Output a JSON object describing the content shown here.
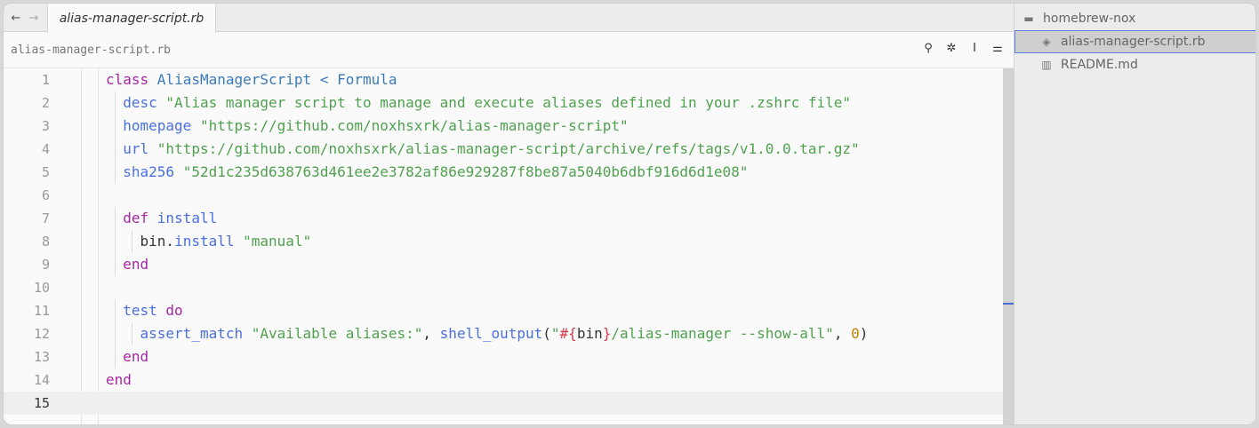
{
  "tabbar": {
    "back_icon": "arrow-left-icon",
    "forward_icon": "arrow-right-icon",
    "active_tab": "alias-manager-script.rb"
  },
  "breadcrumb": "alias-manager-script.rb",
  "toolbar_icons": [
    "search-icon",
    "sparkle-icon",
    "text-cursor-icon",
    "sliders-icon"
  ],
  "editor": {
    "active_line": 15,
    "lines": [
      {
        "n": "1",
        "indent": 0,
        "tokens": [
          [
            "kw",
            "class "
          ],
          [
            "cls",
            "AliasManagerScript"
          ],
          [
            "plain",
            " "
          ],
          [
            "cls",
            "< Formula"
          ]
        ]
      },
      {
        "n": "2",
        "indent": 1,
        "tokens": [
          [
            "fn",
            "desc"
          ],
          [
            "plain",
            " "
          ],
          [
            "str",
            "\"Alias manager script to manage and execute aliases defined in your .zshrc file\""
          ]
        ]
      },
      {
        "n": "3",
        "indent": 1,
        "tokens": [
          [
            "fn",
            "homepage"
          ],
          [
            "plain",
            " "
          ],
          [
            "str",
            "\"https://github.com/noxhsxrk/alias-manager-script\""
          ]
        ]
      },
      {
        "n": "4",
        "indent": 1,
        "tokens": [
          [
            "fn",
            "url"
          ],
          [
            "plain",
            " "
          ],
          [
            "str",
            "\"https://github.com/noxhsxrk/alias-manager-script/archive/refs/tags/v1.0.0.tar.gz\""
          ]
        ]
      },
      {
        "n": "5",
        "indent": 1,
        "tokens": [
          [
            "fn",
            "sha256"
          ],
          [
            "plain",
            " "
          ],
          [
            "str",
            "\"52d1c235d638763d461ee2e3782af86e929287f8be87a5040b6dbf916d6d1e08\""
          ]
        ]
      },
      {
        "n": "6",
        "indent": 0,
        "tokens": []
      },
      {
        "n": "7",
        "indent": 1,
        "tokens": [
          [
            "kw",
            "def"
          ],
          [
            "plain",
            " "
          ],
          [
            "fn",
            "install"
          ]
        ]
      },
      {
        "n": "8",
        "indent": 2,
        "tokens": [
          [
            "plain",
            "bin"
          ],
          [
            "plain",
            "."
          ],
          [
            "fn",
            "install"
          ],
          [
            "plain",
            " "
          ],
          [
            "str",
            "\"manual\""
          ]
        ]
      },
      {
        "n": "9",
        "indent": 1,
        "tokens": [
          [
            "kw",
            "end"
          ]
        ]
      },
      {
        "n": "10",
        "indent": 0,
        "tokens": []
      },
      {
        "n": "11",
        "indent": 1,
        "tokens": [
          [
            "fn",
            "test"
          ],
          [
            "plain",
            " "
          ],
          [
            "kw",
            "do"
          ]
        ]
      },
      {
        "n": "12",
        "indent": 2,
        "tokens": [
          [
            "fn",
            "assert_match"
          ],
          [
            "plain",
            " "
          ],
          [
            "str",
            "\"Available aliases:\""
          ],
          [
            "plain",
            ", "
          ],
          [
            "fn",
            "shell_output"
          ],
          [
            "plain",
            "("
          ],
          [
            "str",
            "\""
          ],
          [
            "int",
            "#{"
          ],
          [
            "plain",
            "bin"
          ],
          [
            "int",
            "}"
          ],
          [
            "str",
            "/alias-manager --show-all\""
          ],
          [
            "plain",
            ", "
          ],
          [
            "num",
            "0"
          ],
          [
            "plain",
            ")"
          ]
        ]
      },
      {
        "n": "13",
        "indent": 1,
        "tokens": [
          [
            "kw",
            "end"
          ]
        ]
      },
      {
        "n": "14",
        "indent": 0,
        "tokens": [
          [
            "kw",
            "end"
          ]
        ]
      },
      {
        "n": "15",
        "indent": 0,
        "tokens": []
      }
    ]
  },
  "sidebar": {
    "folder": {
      "icon": "folder-icon",
      "label": "homebrew-nox"
    },
    "files": [
      {
        "icon": "ruby-file-icon",
        "label": "alias-manager-script.rb",
        "selected": true
      },
      {
        "icon": "book-icon",
        "label": "README.md",
        "selected": false
      }
    ]
  }
}
